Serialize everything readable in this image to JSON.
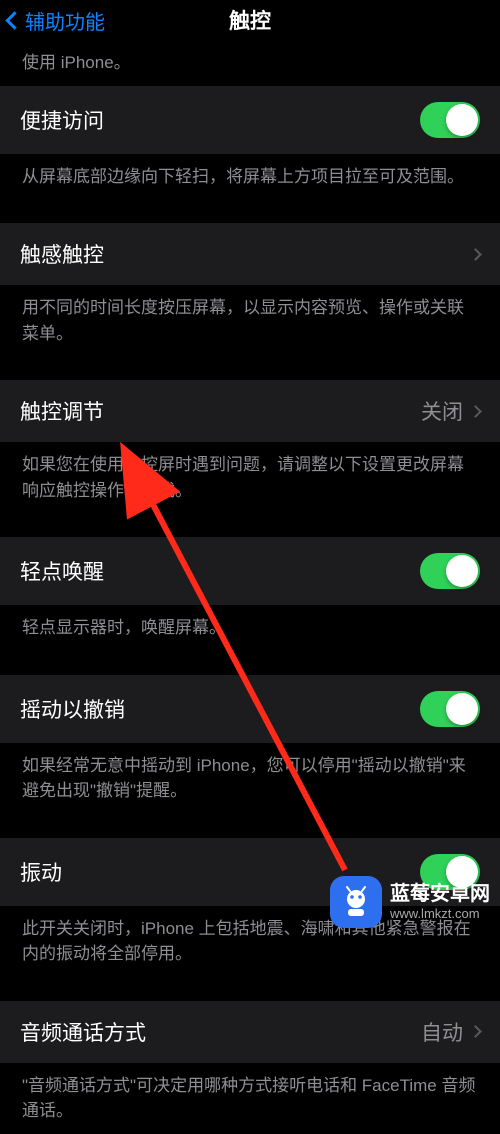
{
  "nav": {
    "back_label": "辅助功能",
    "title": "触控"
  },
  "top_footer_fragment": "使用 iPhone。",
  "sections": [
    {
      "row": {
        "label": "便捷访问",
        "type": "toggle",
        "on": true
      },
      "footer": "从屏幕底部边缘向下轻扫，将屏幕上方项目拉至可及范围。"
    },
    {
      "row": {
        "label": "触感触控",
        "type": "nav"
      },
      "footer": "用不同的时间长度按压屏幕，以显示内容预览、操作或关联菜单。"
    },
    {
      "row": {
        "label": "触控调节",
        "type": "nav_value",
        "value": "关闭"
      },
      "footer": "如果您在使用触控屏时遇到问题，请调整以下设置更改屏幕响应触控操作的方式。"
    },
    {
      "row": {
        "label": "轻点唤醒",
        "type": "toggle",
        "on": true
      },
      "footer": "轻点显示器时，唤醒屏幕。"
    },
    {
      "row": {
        "label": "摇动以撤销",
        "type": "toggle",
        "on": true
      },
      "footer": "如果经常无意中摇动到 iPhone，您可以停用\"摇动以撤销\"来避免出现\"撤销\"提醒。"
    },
    {
      "row": {
        "label": "振动",
        "type": "toggle",
        "on": true
      },
      "footer": "此开关关闭时，iPhone 上包括地震、海啸和其他紧急警报在内的振动将全部停用。"
    },
    {
      "row": {
        "label": "音频通话方式",
        "type": "nav_value",
        "value": "自动"
      },
      "footer": "\"音频通话方式\"可决定用哪种方式接听电话和 FaceTime 音频通话。"
    }
  ],
  "watermark": {
    "name": "蓝莓安卓网",
    "url": "www.lmkzt.com"
  }
}
